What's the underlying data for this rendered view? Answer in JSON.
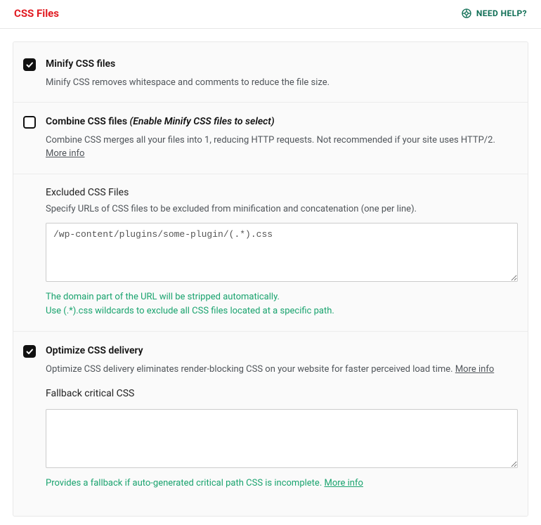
{
  "header": {
    "title": "CSS Files",
    "help_label": "NEED HELP?"
  },
  "options": {
    "minify": {
      "checked": true,
      "label": "Minify CSS files",
      "desc": "Minify CSS removes whitespace and comments to reduce the file size."
    },
    "combine": {
      "checked": false,
      "label": "Combine CSS files",
      "hint": "(Enable Minify CSS files to select)",
      "desc": "Combine CSS merges all your files into 1, reducing HTTP requests. Not recommended if your site uses HTTP/2.",
      "more_info": "More info"
    },
    "excluded": {
      "title": "Excluded CSS Files",
      "desc": "Specify URLs of CSS files to be excluded from minification and concatenation (one per line).",
      "value": "/wp-content/plugins/some-plugin/(.*).css",
      "hint1": "The domain part of the URL will be stripped automatically.",
      "hint2": "Use (.*).css wildcards to exclude all CSS files located at a specific path."
    },
    "optimize": {
      "checked": true,
      "label": "Optimize CSS delivery",
      "desc": "Optimize CSS delivery eliminates render-blocking CSS on your website for faster perceived load time.",
      "more_info": "More info"
    },
    "fallback": {
      "title": "Fallback critical CSS",
      "value": "",
      "hint": "Provides a fallback if auto-generated critical path CSS is incomplete.",
      "more_info": "More info"
    }
  }
}
